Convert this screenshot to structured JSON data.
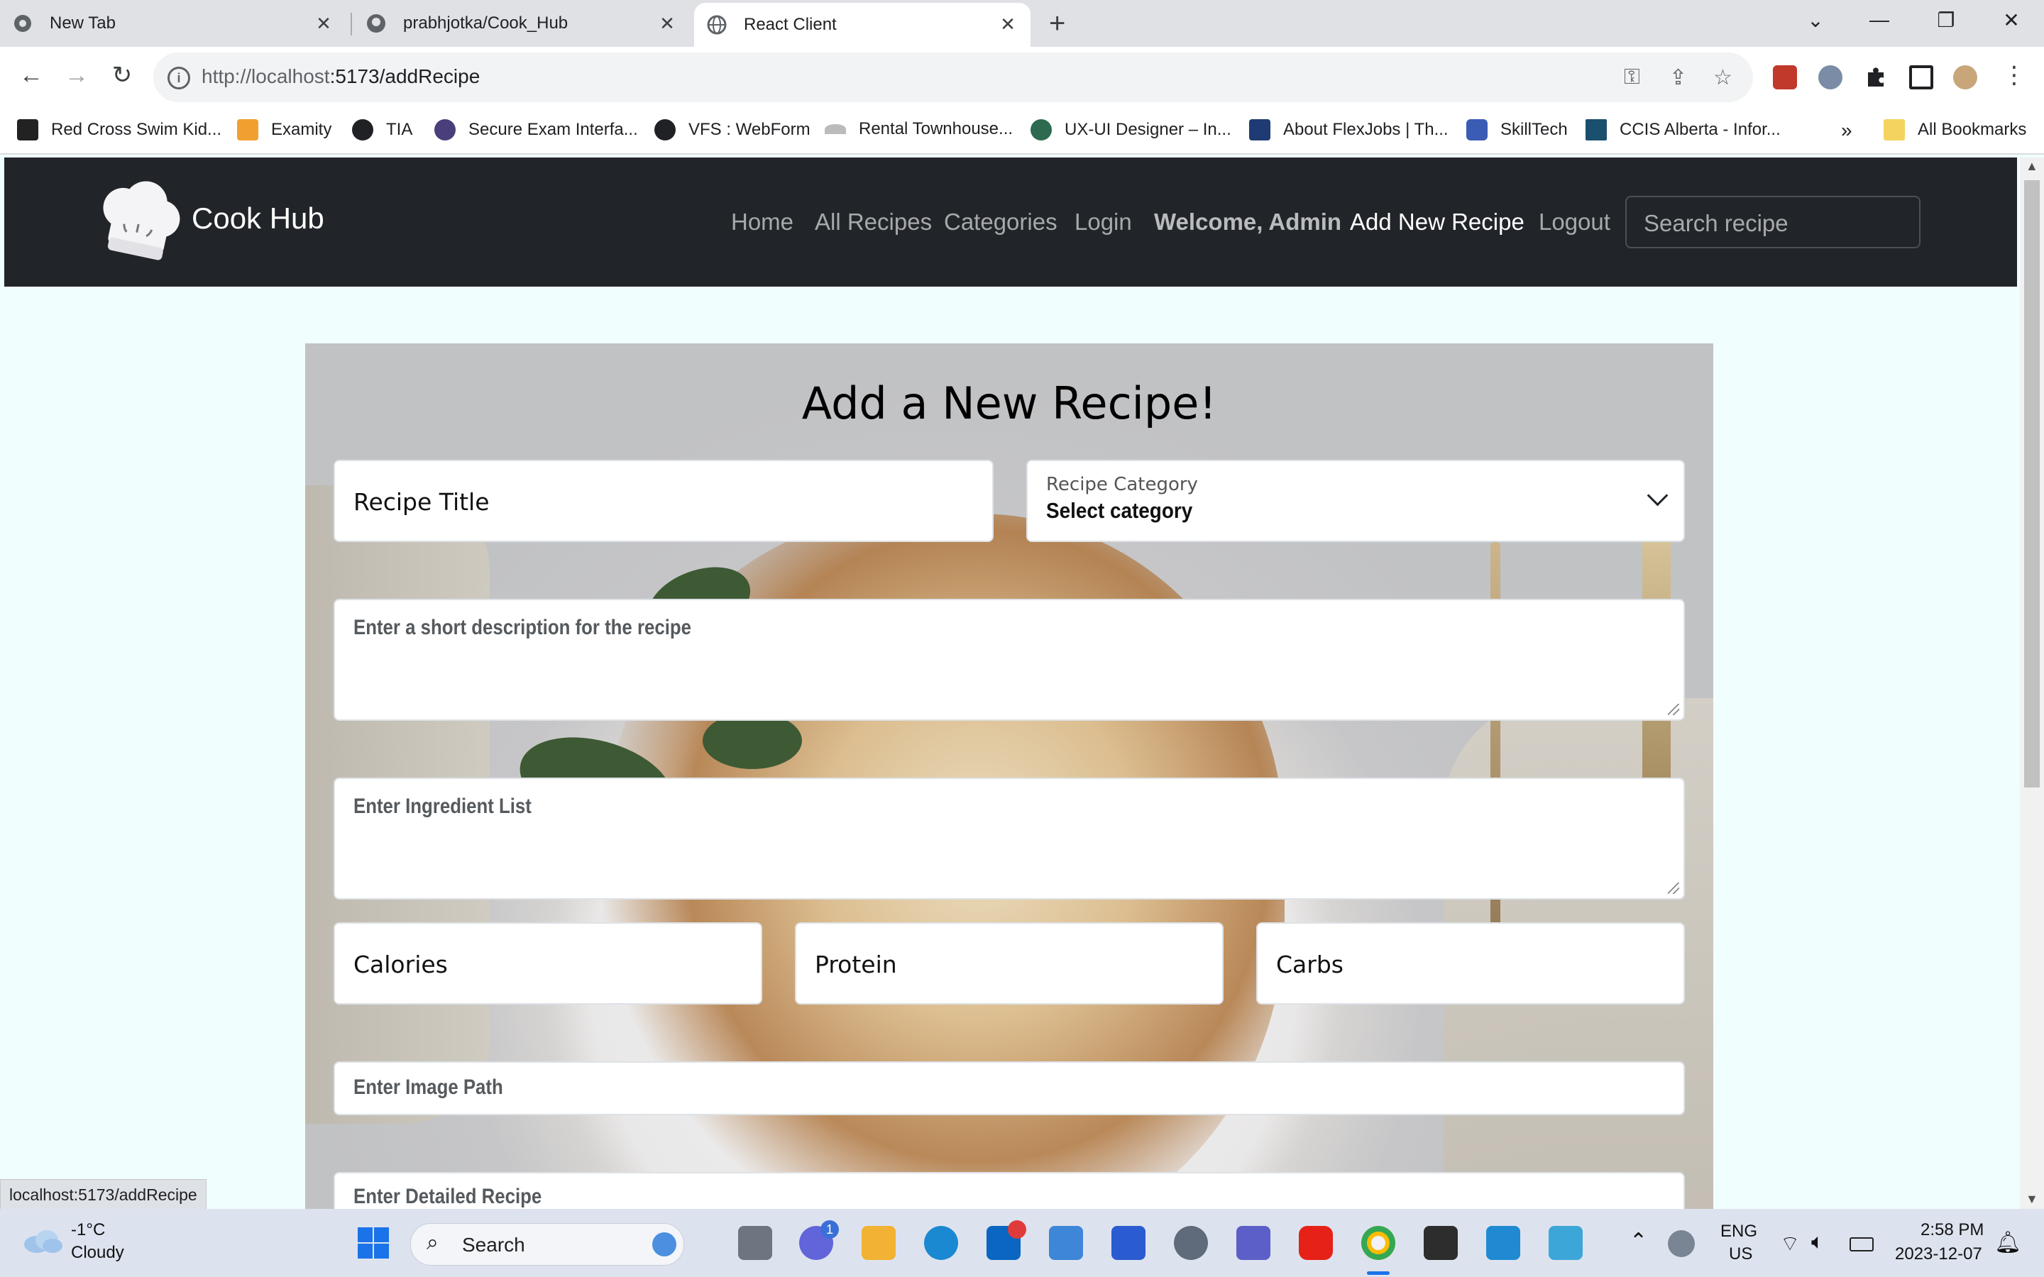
{
  "browser": {
    "tabs": [
      {
        "title": "New Tab",
        "active": false
      },
      {
        "title": "prabhjotka/Cook_Hub",
        "active": false
      },
      {
        "title": "React Client",
        "active": true
      }
    ],
    "url_host": "http://localhost",
    "url_rest": ":5173/addRecipe",
    "bookmarks": [
      "Red Cross Swim Kid...",
      "Examity",
      "TIA",
      "Secure Exam Interfa...",
      "VFS : WebForm",
      "Rental Townhouse...",
      "UX-UI Designer – In...",
      "About FlexJobs | Th...",
      "SkillTech",
      "CCIS Alberta - Infor..."
    ],
    "bookmarks_overflow": "»",
    "all_bookmarks": "All Bookmarks",
    "status_url": "localhost:5173/addRecipe"
  },
  "navbar": {
    "brand": "Cook Hub",
    "links": {
      "home": "Home",
      "all_recipes": "All Recipes",
      "categories": "Categories",
      "login": "Login",
      "welcome": "Welcome, Admin",
      "add_new_recipe": "Add New Recipe",
      "logout": "Logout"
    },
    "search_placeholder": "Search recipe"
  },
  "form": {
    "heading": "Add a New Recipe!",
    "recipe_title_placeholder": "Recipe Title",
    "category_label": "Recipe Category",
    "category_value": "Select category",
    "description_placeholder": "Enter a short description for the recipe",
    "ingredients_placeholder": "Enter Ingredient List",
    "calories_placeholder": "Calories",
    "protein_placeholder": "Protein",
    "carbs_placeholder": "Carbs",
    "image_path_placeholder": "Enter Image Path",
    "detailed_recipe_placeholder": "Enter Detailed Recipe"
  },
  "taskbar": {
    "weather_temp": "-1°C",
    "weather_desc": "Cloudy",
    "search_label": "Search",
    "teams_badge": "1",
    "lang_top": "ENG",
    "lang_bottom": "US",
    "time": "2:58 PM",
    "date": "2023-12-07"
  }
}
